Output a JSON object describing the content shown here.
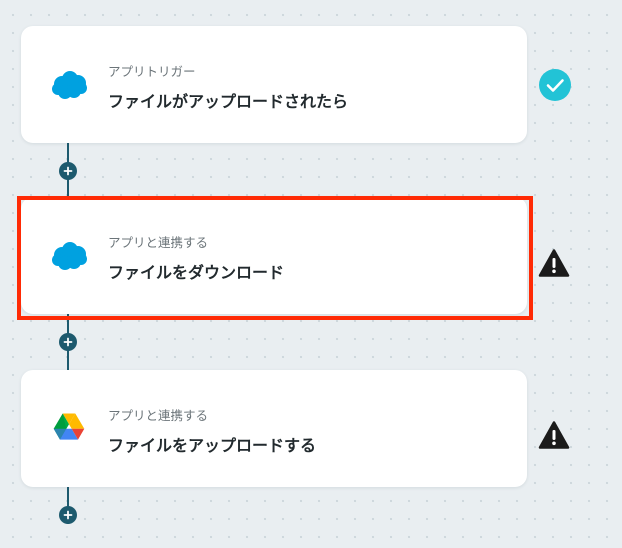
{
  "flow": {
    "steps": [
      {
        "category": "アプリトリガー",
        "title": "ファイルがアップロードされたら",
        "app_icon": "salesforce-cloud-icon",
        "status": "complete",
        "status_icon": "check-circle-icon"
      },
      {
        "category": "アプリと連携する",
        "title": "ファイルをダウンロード",
        "app_icon": "salesforce-cloud-icon",
        "status": "warning",
        "status_icon": "warning-triangle-icon",
        "highlighted": true
      },
      {
        "category": "アプリと連携する",
        "title": "ファイルをアップロードする",
        "app_icon": "google-drive-icon",
        "status": "warning",
        "status_icon": "warning-triangle-icon"
      }
    ],
    "add_button_icon": "plus-icon"
  },
  "colors": {
    "background": "#e9eef1",
    "connector": "#1d5a6e",
    "check": "#22c3d6",
    "warning": "#1b1b1b",
    "highlight": "#ff2a05",
    "salesforce": "#00a1e0"
  }
}
